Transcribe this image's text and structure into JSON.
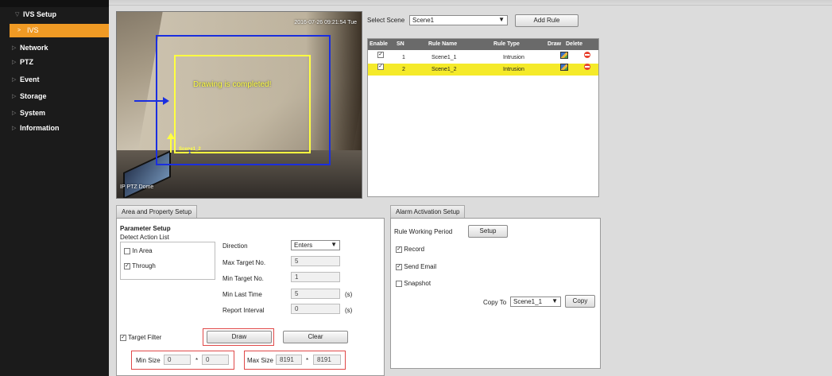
{
  "sidebar": {
    "header": "IVS Setup",
    "active_item": "IVS",
    "items": [
      "Network",
      "PTZ",
      "Event",
      "Storage",
      "System",
      "Information"
    ]
  },
  "video": {
    "timestamp": "2016-07-26 09:21:54 Tue",
    "camera_name": "IP PTZ Dome",
    "status_message": "Drawing is completed!",
    "rule_label_yellow": "Scene1_2",
    "rule_label_blue": "1"
  },
  "scene": {
    "label": "Select Scene",
    "value": "Scene1",
    "add_rule": "Add Rule"
  },
  "rule_table": {
    "columns": [
      "Enable",
      "SN",
      "Rule Name",
      "Rule Type",
      "Draw",
      "Delete"
    ],
    "rows": [
      {
        "enabled": "✓",
        "sn": "1",
        "name": "Scene1_1",
        "type": "Intrusion",
        "selected": false
      },
      {
        "enabled": "✓",
        "sn": "2",
        "name": "Scene1_2",
        "type": "Intrusion",
        "selected": true
      }
    ]
  },
  "area": {
    "tab": "Area and Property Setup",
    "param_title": "Parameter Setup",
    "action_list_label": "Detect Action List",
    "actions": [
      {
        "label": "In Area",
        "checked": ""
      },
      {
        "label": "Through",
        "checked": "✓"
      }
    ],
    "direction_label": "Direction",
    "direction_value": "Enters",
    "max_target_label": "Max Target No.",
    "max_target_value": "5",
    "min_target_label": "Min Target No.",
    "min_target_value": "1",
    "min_last_label": "Min Last Time",
    "min_last_value": "5",
    "min_last_unit": "(s)",
    "report_label": "Report Interval",
    "report_value": "0",
    "report_unit": "(s)",
    "target_filter_label": "Target Filter",
    "target_filter_checked": "✓",
    "draw_button": "Draw",
    "clear_button": "Clear",
    "min_size_label": "Min Size",
    "min_size_w": "0",
    "min_size_h": "0",
    "max_size_label": "Max Size",
    "max_size_w": "8191",
    "max_size_h": "8191",
    "times": "*"
  },
  "alarm": {
    "tab": "Alarm Activation Setup",
    "working_period_label": "Rule Working Period",
    "setup_button": "Setup",
    "options": [
      {
        "label": "Record",
        "checked": "✓"
      },
      {
        "label": "Send Email",
        "checked": "✓"
      },
      {
        "label": "Snapshot",
        "checked": ""
      }
    ],
    "copy_to_label": "Copy To",
    "copy_to_value": "Scene1_1",
    "copy_button": "Copy"
  },
  "colors": {
    "sidebar_bg": "#1b1b1b",
    "active_orange": "#f09a24",
    "selected_row": "#f5ea2a",
    "rule_yellow": "#ffff40",
    "rule_blue": "#1a2ee0",
    "highlight_red": "#e04848"
  }
}
